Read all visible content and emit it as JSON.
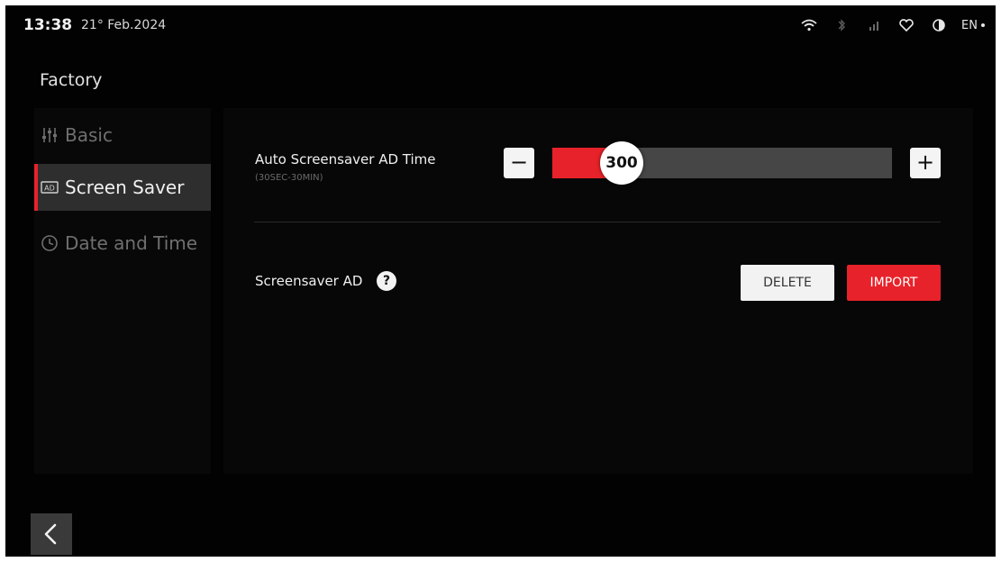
{
  "status_bar": {
    "time": "13:38",
    "date": "21° Feb.2024",
    "language": "EN",
    "icons": [
      "wifi-icon",
      "bluetooth-icon",
      "signal-icon",
      "heart-icon",
      "contrast-icon"
    ]
  },
  "page": {
    "title": "Factory"
  },
  "sidebar": {
    "items": [
      {
        "label": "Basic",
        "icon": "sliders-icon",
        "active": false
      },
      {
        "label": "Screen Saver",
        "icon": "ad-icon",
        "active": true
      },
      {
        "label": "Date and Time",
        "icon": "clock-icon",
        "active": false
      }
    ]
  },
  "settings": {
    "auto_screensaver": {
      "label": "Auto Screensaver AD Time",
      "range_hint": "(30SEC-30MIN)",
      "value": "300",
      "fill_fraction": 0.14,
      "minus_label": "−",
      "plus_label": "+"
    },
    "screensaver_ad": {
      "label": "Screensaver AD",
      "help_label": "?",
      "delete_label": "DELETE",
      "import_label": "IMPORT"
    }
  },
  "colors": {
    "accent": "#e8222a",
    "background": "#020202",
    "active_item": "#2e2e2e"
  },
  "back_button": {
    "icon": "chevron-left-icon"
  }
}
